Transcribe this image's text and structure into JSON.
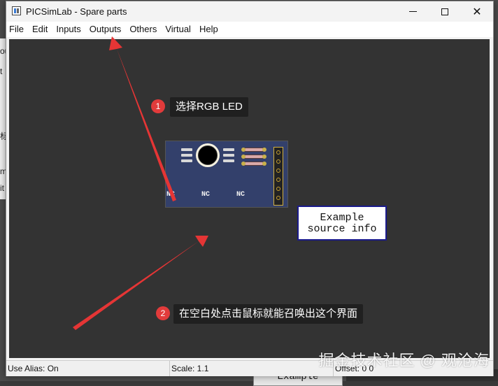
{
  "window": {
    "title": "PICSimLab - Spare parts",
    "controls": {
      "minimize": "minimize",
      "maximize": "maximize",
      "close": "✕"
    }
  },
  "menubar": {
    "items": [
      "File",
      "Edit",
      "Inputs",
      "Outputs",
      "Others",
      "Virtual",
      "Help"
    ]
  },
  "board": {
    "labels": [
      "NC",
      "NC",
      "NC"
    ]
  },
  "info_box": {
    "line1": "Example",
    "line2": "source info"
  },
  "annotations": [
    {
      "number": "1",
      "text": "选择RGB LED"
    },
    {
      "number": "2",
      "text": "在空白处点击鼠标就能召唤出这个界面"
    }
  ],
  "statusbar": {
    "use_alias": "Use Alias: On",
    "scale": "Scale: 1.1",
    "offset": "Offset:  0  0"
  },
  "background": {
    "edge_texts": [
      "ou",
      "t",
      "标",
      "m",
      "it"
    ],
    "bottom_button": "Example"
  },
  "watermark": "掘金技术社区 @ 观沧海",
  "colors": {
    "canvas": "#333333",
    "board": "#33406b",
    "annotation_badge": "#e23b3b",
    "arrow": "#e53535",
    "info_border": "#1a1a8c"
  },
  "icons": [
    "app-icon",
    "minimize-icon",
    "maximize-icon",
    "close-icon",
    "led-icon",
    "arrow-icon"
  ]
}
